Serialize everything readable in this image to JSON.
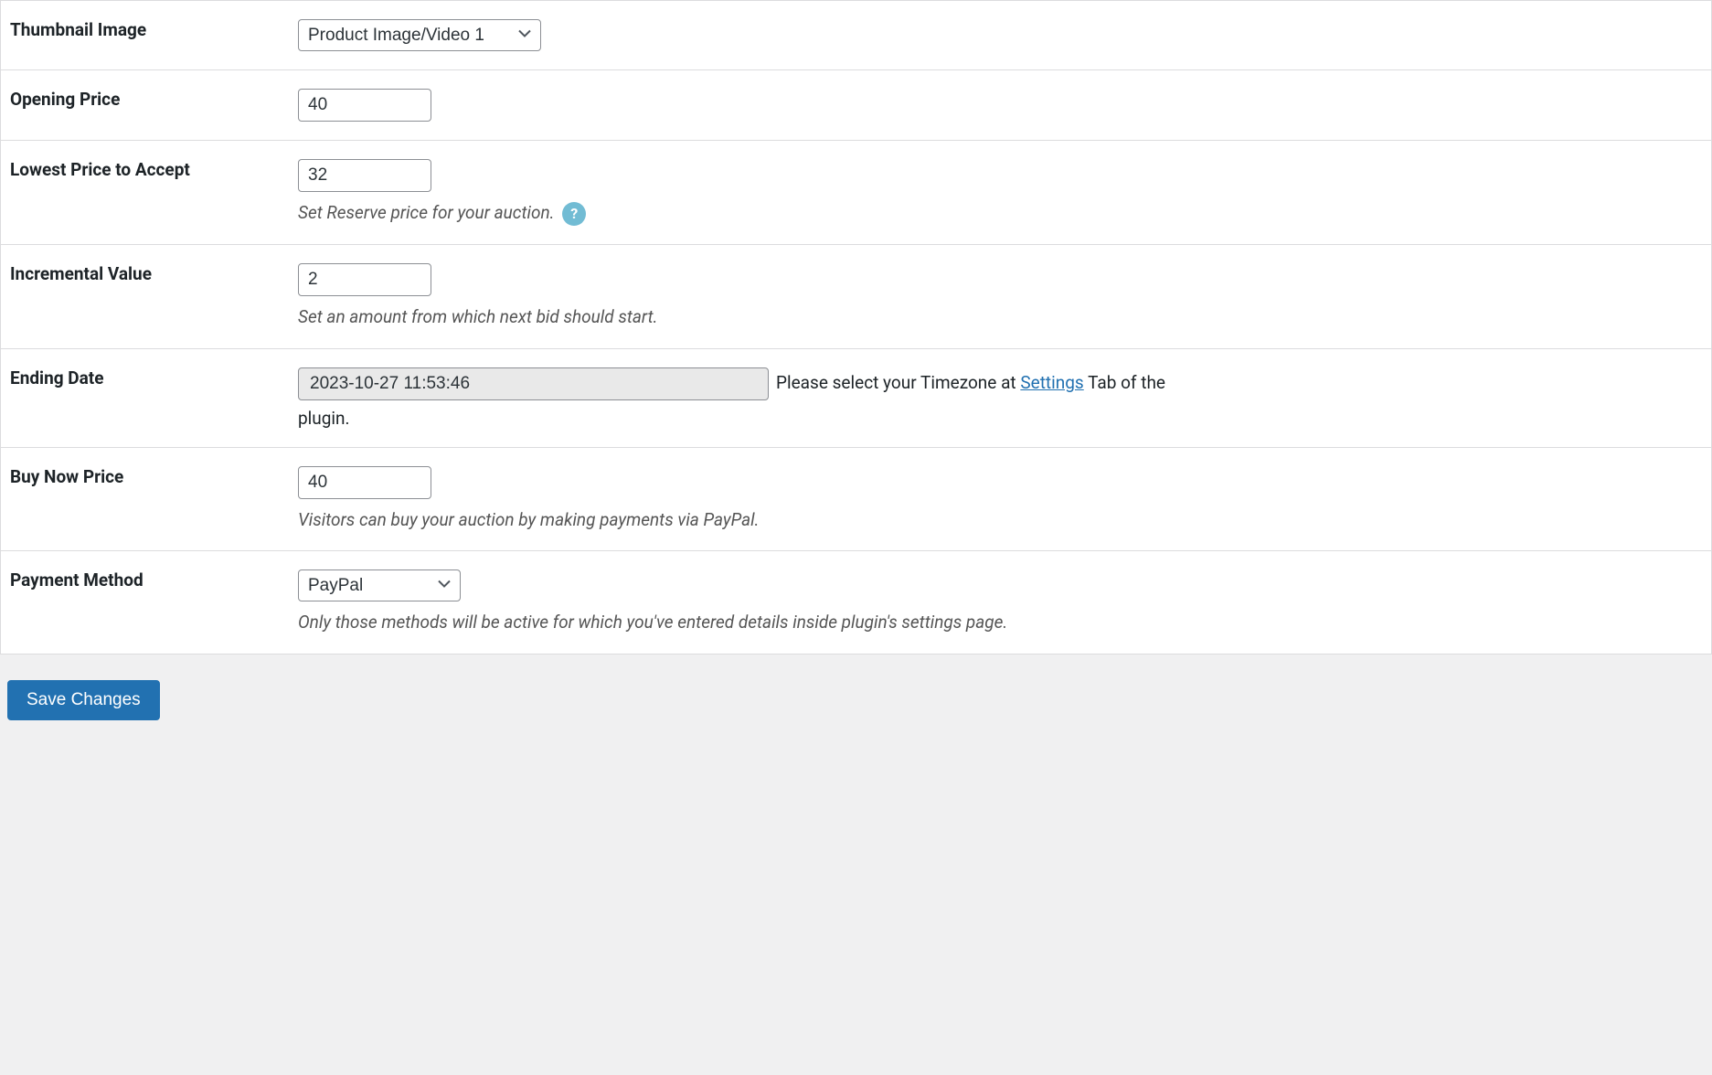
{
  "fields": {
    "thumbnail": {
      "label": "Thumbnail Image",
      "value": "Product Image/Video 1"
    },
    "opening_price": {
      "label": "Opening Price",
      "value": "40"
    },
    "lowest_price": {
      "label": "Lowest Price to Accept",
      "value": "32",
      "help": "Set Reserve price for your auction."
    },
    "incremental": {
      "label": "Incremental Value",
      "value": "2",
      "help": "Set an amount from which next bid should start."
    },
    "ending_date": {
      "label": "Ending Date",
      "value": "2023-10-27 11:53:46",
      "help_prefix": "Please select your Timezone at ",
      "help_link": "Settings",
      "help_suffix": " Tab of the",
      "help_line2": "plugin."
    },
    "buy_now": {
      "label": "Buy Now Price",
      "value": "40",
      "help": "Visitors can buy your auction by making payments via PayPal."
    },
    "payment_method": {
      "label": "Payment Method",
      "value": "PayPal",
      "help": "Only those methods will be active for which you've entered details inside plugin's settings page."
    }
  },
  "buttons": {
    "save": "Save Changes"
  },
  "icons": {
    "help": "?"
  }
}
